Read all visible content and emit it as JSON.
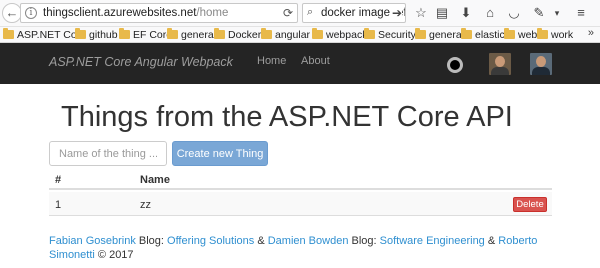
{
  "browser": {
    "url_host": "thingsclient.azurewebsites.net",
    "url_path": "/home",
    "search_query": "docker image ref",
    "icons": [
      "back-icon",
      "info-icon",
      "reload-icon",
      "search-icon",
      "go-arrow-icon",
      "star-icon",
      "reader-icon",
      "download-icon",
      "home-icon",
      "pocket-icon",
      "extension-icon",
      "menu-icon"
    ]
  },
  "bookmarks": {
    "items": [
      "ASP.NET Core",
      "github",
      "EF Core",
      "general",
      "Docker",
      "angular",
      "webpack",
      "Security",
      "general",
      "elastic",
      "web",
      "work"
    ],
    "more": "»"
  },
  "navbar": {
    "brand": "ASP.NET Core Angular Webpack",
    "links": [
      "Home",
      "About"
    ]
  },
  "main": {
    "title": "Things from the ASP.NET Core API",
    "input_placeholder": "Name of the thing ...",
    "create_button": "Create new Thing",
    "table": {
      "headers": [
        "#",
        "Name"
      ],
      "rows": [
        {
          "id": "1",
          "name": "zz",
          "delete_label": "Delete"
        }
      ]
    }
  },
  "footer": {
    "author1": "Fabian Gosebrink",
    "blog_label_1": " Blog: ",
    "blog1": "Offering Solutions",
    "amp1": " & ",
    "author2": "Damien Bowden",
    "blog_label_2": " Blog: ",
    "blog2": "Software Engineering",
    "amp2": " & ",
    "author3": "Roberto Simonetti",
    "copyright": " © 2017"
  },
  "colors": {
    "navbar_bg": "#242424",
    "primary_button": "#7aa7d6",
    "danger_button": "#d9534f",
    "link": "#2f8fd0"
  }
}
